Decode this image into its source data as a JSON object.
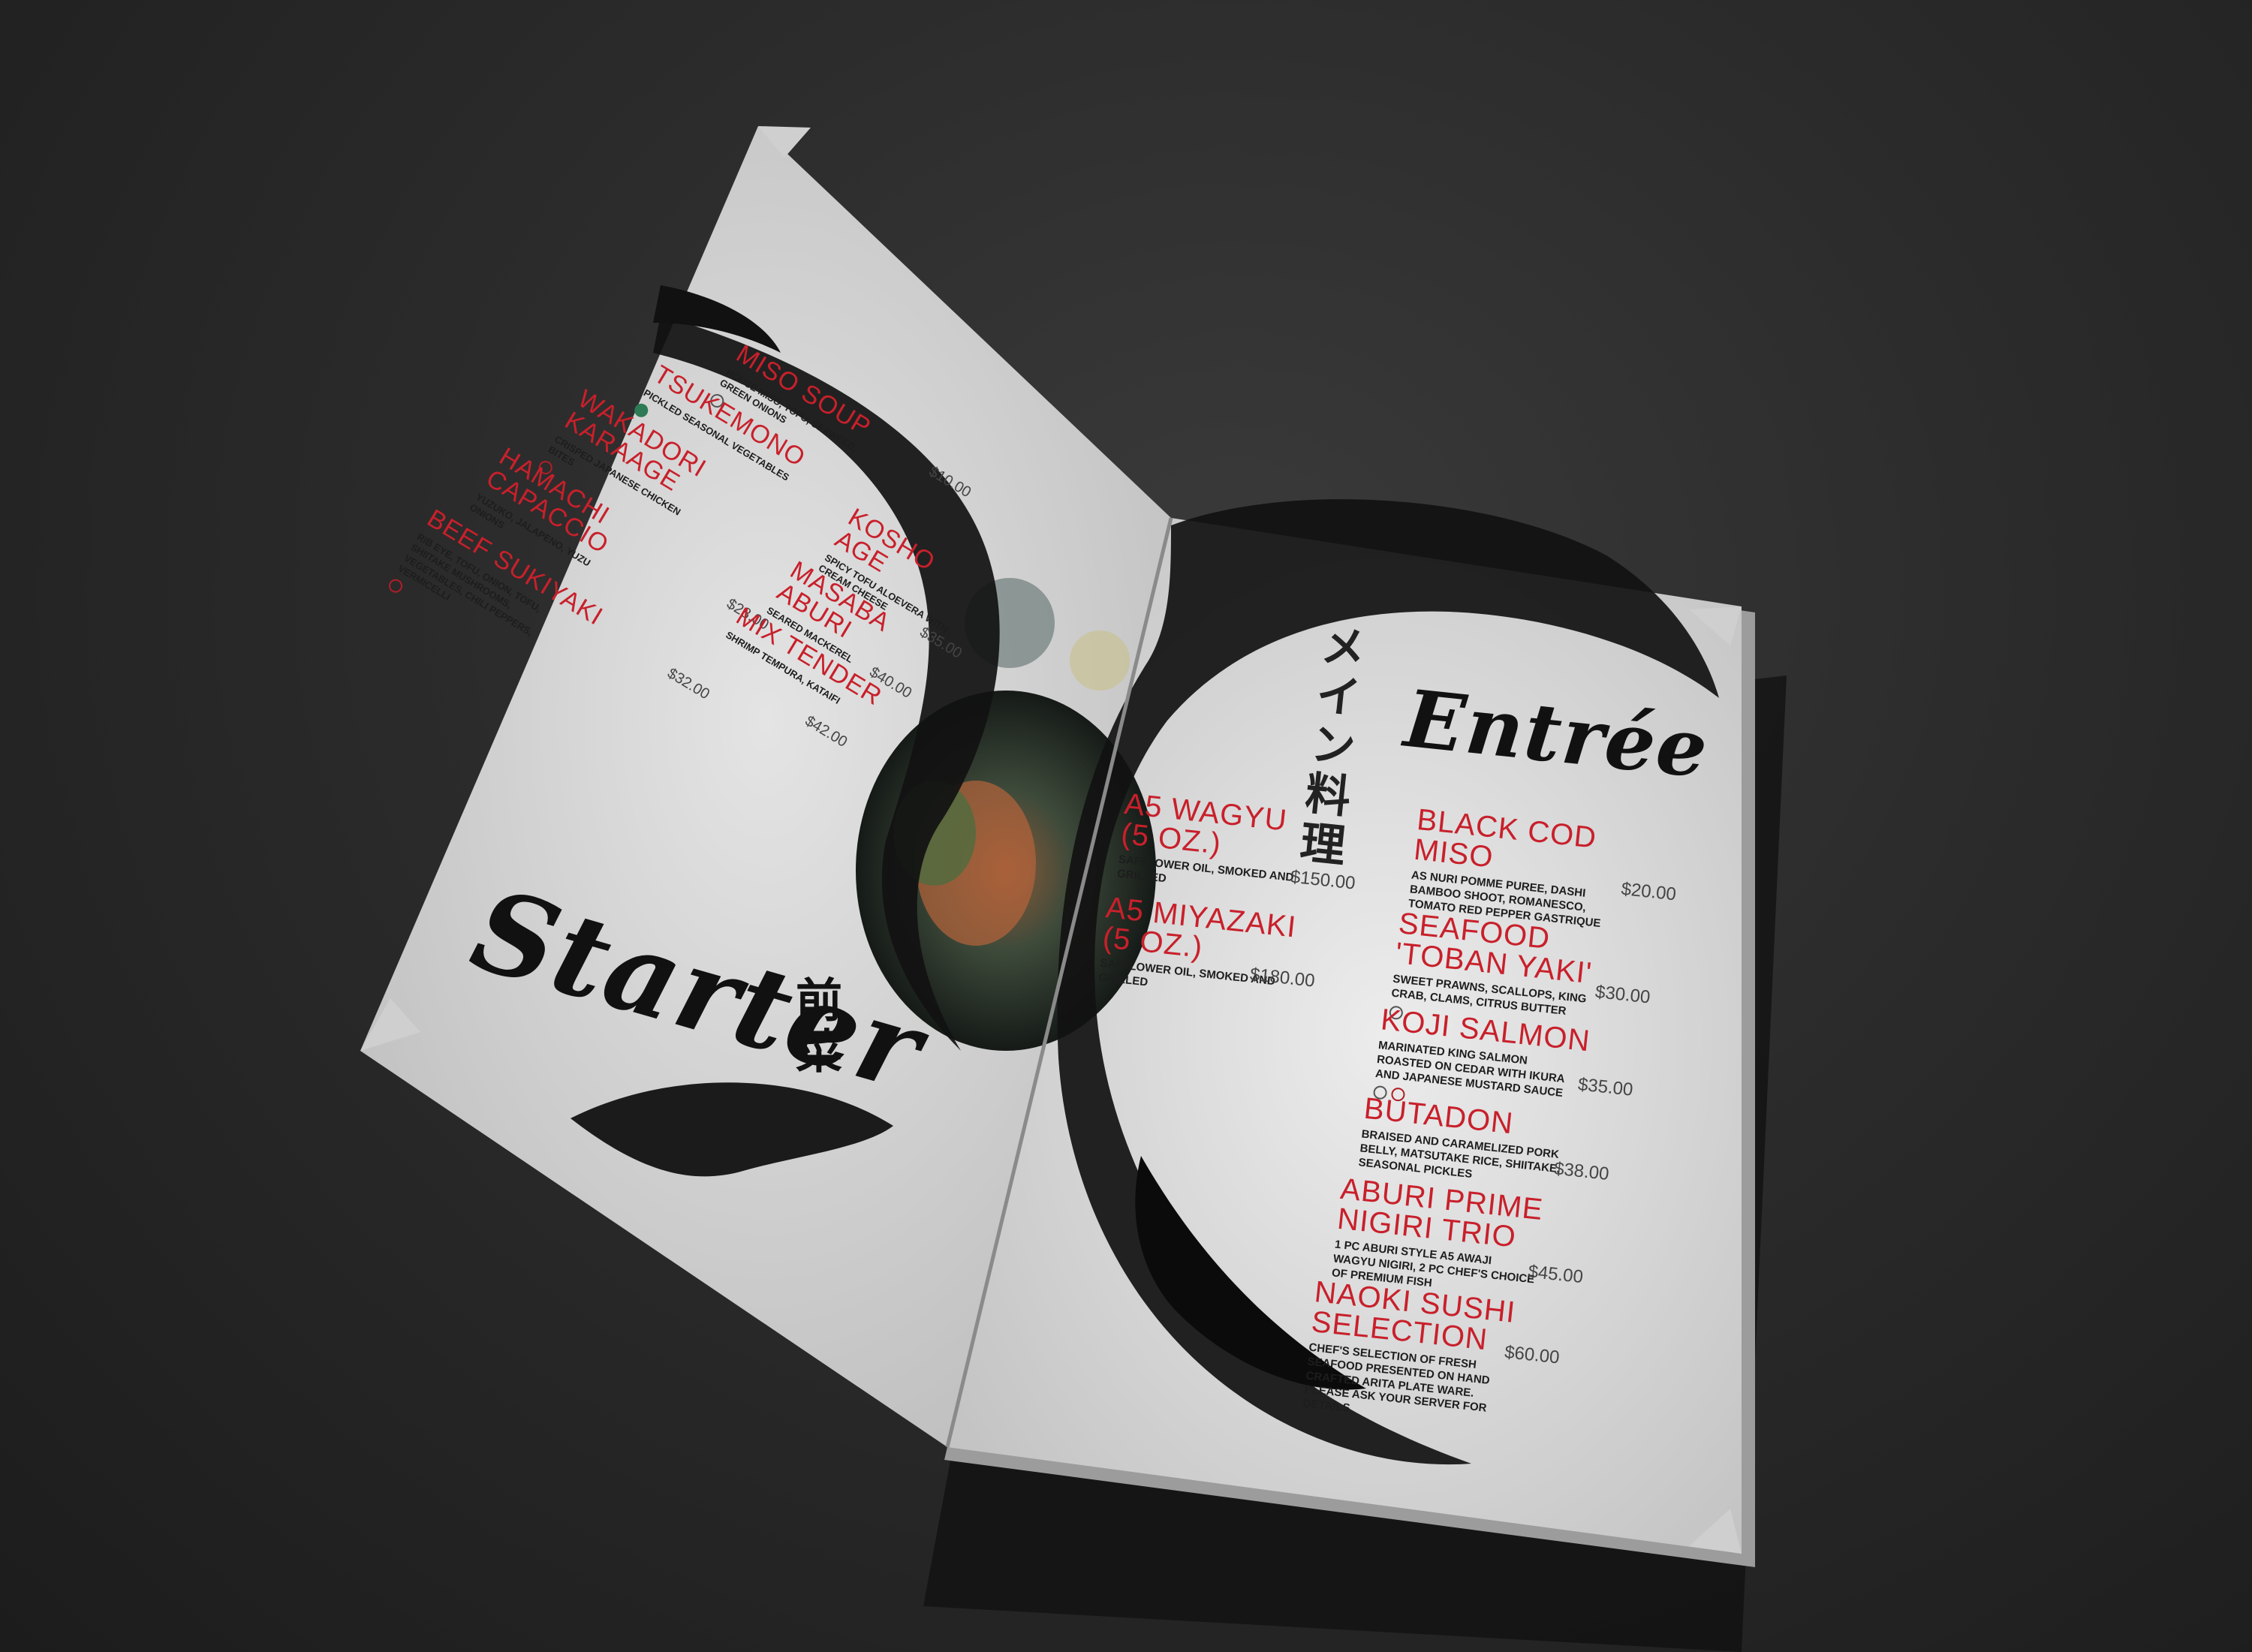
{
  "colors": {
    "background": "#2b2b2b",
    "paper": "#dedede",
    "ink": "#111111",
    "accent": "#c8202b"
  },
  "left_page": {
    "title": "Starter",
    "kanji": "前菜",
    "items": [
      {
        "name": "MISO SOUP",
        "desc": "HOUSE MISO, TOFU, SEAWEED, GREEN ONIONS",
        "price": "$10.00"
      },
      {
        "name": "TSUKEMONO",
        "desc": "PICKLED SEASONAL VEGETABLES",
        "price": ""
      },
      {
        "name": "WAKADORI\nKARAAGE",
        "desc": "CRISPED JAPANESE CHICKEN BITES",
        "price": ""
      },
      {
        "name": "HAMACHI\nCAPACCIO",
        "desc": "YUZUKO, JALAPENO, YUZU ONIONS",
        "price": "$28.00"
      },
      {
        "name": "BEEF SUKIYAKI",
        "desc": "RIB EYE, TOFU, ONION, TOFU, SHIITAKE MUSHROOMS, VEGETABLES, CHILI PEPPERS, VERMICELLI",
        "price": "$32.00"
      }
    ],
    "items_col2": [
      {
        "name": "KOSHO AGE",
        "desc": "SPICY TOFU ALOEVERA WITH CREAM CHEESE",
        "price": "$35.00"
      },
      {
        "name": "MASABA\nABURI",
        "desc": "SEARED MACKEREL",
        "price": "$40.00"
      },
      {
        "name": "MIX TENDER",
        "desc": "SHRIMP TEMPURA, KATAIFI",
        "price": "$42.00"
      }
    ]
  },
  "right_page": {
    "title": "Entrée",
    "kanji": "メイン料理",
    "items_left": [
      {
        "name": "A5 WAGYU\n(5 OZ.)",
        "desc": "SAFFLOWER OIL, SMOKED AND GRILLED",
        "price": "$150.00"
      },
      {
        "name": "A5 MIYAZAKI\n(5 OZ.)",
        "desc": "SAFFLOWER OIL, SMOKED AND GRILLED",
        "price": "$180.00"
      }
    ],
    "items_right": [
      {
        "name": "BLACK COD\nMISO",
        "desc": "AS NURI POMME PUREE, DASHI BAMBOO SHOOT, ROMANESCO, TOMATO RED PEPPER GASTRIQUE",
        "price": "$20.00"
      },
      {
        "name": "SEAFOOD\n'TOBAN YAKI'",
        "desc": "SWEET PRAWNS, SCALLOPS, KING CRAB, CLAMS, CITRUS BUTTER",
        "price": "$30.00"
      },
      {
        "name": "KOJI SALMON",
        "desc": "MARINATED KING SALMON ROASTED ON CEDAR WITH IKURA AND JAPANESE MUSTARD SAUCE",
        "price": "$35.00"
      },
      {
        "name": "BUTADON",
        "desc": "BRAISED AND CARAMELIZED PORK BELLY, MATSUTAKE RICE, SHIITAKE, SEASONAL PICKLES",
        "price": "$38.00"
      },
      {
        "name": "ABURI PRIME\nNIGIRI TRIO",
        "desc": "1 PC ABURI STYLE A5 AWAJI WAGYU NIGIRI, 2 PC CHEF'S CHOICE OF PREMIUM FISH",
        "price": "$45.00"
      },
      {
        "name": "NAOKI SUSHI\nSELECTION",
        "desc": "CHEF'S SELECTION OF FRESH SEAFOOD PRESENTED ON HAND CRAFTED ARITA PLATE WARE. PLEASE ASK YOUR SERVER FOR DETAILS",
        "price": "$60.00"
      }
    ]
  }
}
